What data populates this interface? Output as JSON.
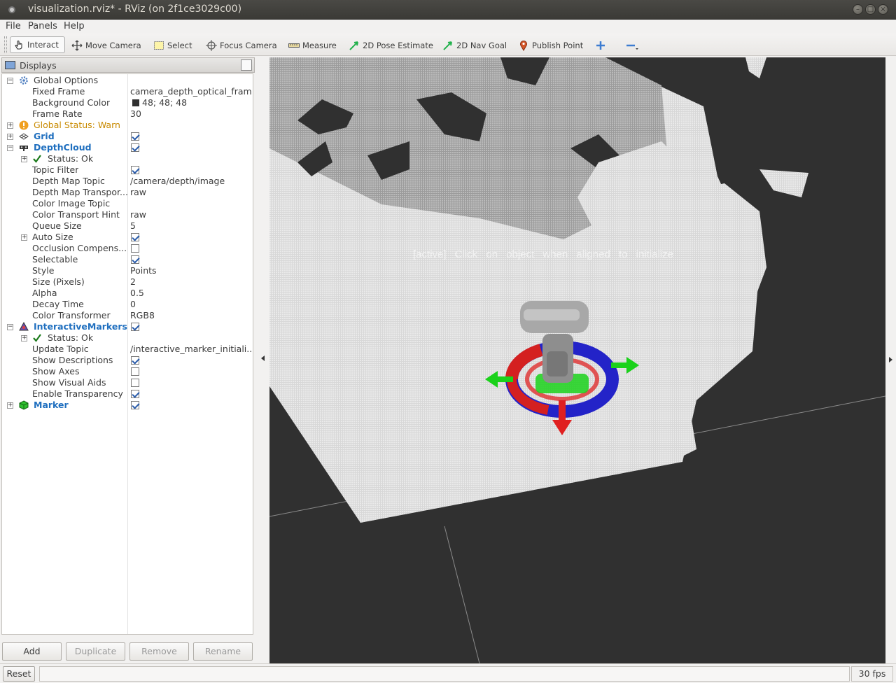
{
  "window": {
    "title": "visualization.rviz* - RViz (on 2f1ce3029c00)"
  },
  "menu": {
    "file": "File",
    "panels": "Panels",
    "help": "Help"
  },
  "toolbar": {
    "interact": "Interact",
    "move_camera": "Move Camera",
    "select": "Select",
    "focus_camera": "Focus Camera",
    "measure": "Measure",
    "pose_estimate": "2D Pose Estimate",
    "nav_goal": "2D Nav Goal",
    "publish_point": "Publish Point"
  },
  "displays_panel": {
    "title": "Displays",
    "rows": [
      {
        "label": "Global Options",
        "value": ""
      },
      {
        "label": "Fixed Frame",
        "value": "camera_depth_optical_frame"
      },
      {
        "label": "Background Color",
        "value": "48; 48; 48"
      },
      {
        "label": "Frame Rate",
        "value": "30"
      },
      {
        "label": "Global Status: Warn",
        "value": ""
      },
      {
        "label": "Grid",
        "value": ""
      },
      {
        "label": "DepthCloud",
        "value": ""
      },
      {
        "label": "Status: Ok",
        "value": ""
      },
      {
        "label": "Topic Filter",
        "value": ""
      },
      {
        "label": "Depth Map Topic",
        "value": "/camera/depth/image"
      },
      {
        "label": "Depth Map Transpor...",
        "value": "raw"
      },
      {
        "label": "Color Image Topic",
        "value": ""
      },
      {
        "label": "Color Transport Hint",
        "value": "raw"
      },
      {
        "label": "Queue Size",
        "value": "5"
      },
      {
        "label": "Auto Size",
        "value": ""
      },
      {
        "label": "Occlusion Compens...",
        "value": ""
      },
      {
        "label": "Selectable",
        "value": ""
      },
      {
        "label": "Style",
        "value": "Points"
      },
      {
        "label": "Size (Pixels)",
        "value": "2"
      },
      {
        "label": "Alpha",
        "value": "0.5"
      },
      {
        "label": "Decay Time",
        "value": "0"
      },
      {
        "label": "Color Transformer",
        "value": "RGB8"
      },
      {
        "label": "InteractiveMarkers",
        "value": ""
      },
      {
        "label": "Status: Ok",
        "value": ""
      },
      {
        "label": "Update Topic",
        "value": "/interactive_marker_initiali..."
      },
      {
        "label": "Show Descriptions",
        "value": ""
      },
      {
        "label": "Show Axes",
        "value": ""
      },
      {
        "label": "Show Visual Aids",
        "value": ""
      },
      {
        "label": "Enable Transparency",
        "value": ""
      },
      {
        "label": "Marker",
        "value": ""
      }
    ],
    "checkboxes": {
      "grid": true,
      "depthcloud": true,
      "topic_filter": true,
      "auto_size": true,
      "occlusion": false,
      "selectable": true,
      "interactive_markers": true,
      "show_descriptions": true,
      "show_axes": false,
      "show_visual_aids": false,
      "enable_transparency": true,
      "marker": true
    },
    "background_color_swatch": "#303030"
  },
  "panel_buttons": {
    "add": "Add",
    "duplicate": "Duplicate",
    "remove": "Remove",
    "rename": "Rename"
  },
  "viewport": {
    "overlay_text": "[active] Click on object when aligned to initialize",
    "background": "#303030"
  },
  "status": {
    "reset": "Reset",
    "fps": "30 fps"
  }
}
